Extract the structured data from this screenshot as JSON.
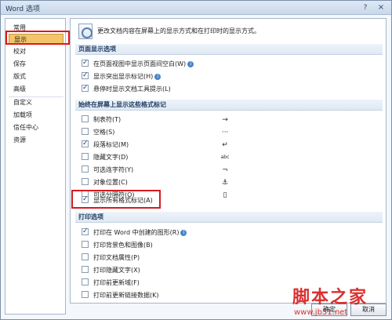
{
  "window": {
    "title": "Word 选项",
    "help_glyph": "?",
    "close_glyph": "×"
  },
  "sidebar": {
    "items": [
      {
        "label": "常用"
      },
      {
        "label": "显示",
        "selected": true
      },
      {
        "label": "校对"
      },
      {
        "label": "保存"
      },
      {
        "label": "版式"
      },
      {
        "label": "高级"
      },
      {
        "label": "自定义"
      },
      {
        "label": "加载项"
      },
      {
        "label": "信任中心"
      },
      {
        "label": "资源"
      }
    ]
  },
  "intro": {
    "text": "更改文档内容在屏幕上的显示方式和在打印时的显示方式。"
  },
  "sections": {
    "page_display": {
      "title": "页面显示选项",
      "options": [
        {
          "label": "在页面视图中显示页面间空白(W)",
          "checked": true,
          "info": "i"
        },
        {
          "label": "显示突出显示标记(H)",
          "checked": true,
          "info": "i"
        },
        {
          "label": "悬停时显示文档工具提示(L)",
          "checked": true
        }
      ]
    },
    "formatting_marks": {
      "title": "始终在屏幕上显示这些格式标记",
      "options": [
        {
          "label": "制表符(T)",
          "checked": false,
          "glyph": "→"
        },
        {
          "label": "空格(S)",
          "checked": false,
          "glyph": "···"
        },
        {
          "label": "段落标记(M)",
          "checked": true,
          "glyph": "↵"
        },
        {
          "label": "隐藏文字(D)",
          "checked": false,
          "glyph": "abc"
        },
        {
          "label": "可选连字符(Y)",
          "checked": false,
          "glyph": "¬"
        },
        {
          "label": "对象位置(C)",
          "checked": false,
          "glyph": "⚓"
        },
        {
          "label": "可选分隔符(O)",
          "checked": false,
          "glyph": "▯"
        },
        {
          "label": "显示所有格式标记(A)",
          "checked": true
        }
      ]
    },
    "printing": {
      "title": "打印选项",
      "options": [
        {
          "label": "打印在 Word 中创建的图形(R)",
          "checked": true,
          "info": "i"
        },
        {
          "label": "打印背景色和图像(B)",
          "checked": false
        },
        {
          "label": "打印文档属性(P)",
          "checked": false
        },
        {
          "label": "打印隐藏文字(X)",
          "checked": false
        },
        {
          "label": "打印前更新域(F)",
          "checked": false
        },
        {
          "label": "打印前更新链接数据(K)",
          "checked": false
        }
      ]
    }
  },
  "buttons": {
    "ok": "确定",
    "cancel": "取消"
  },
  "watermark": {
    "text": "脚本之家",
    "url": "www.jb51.net"
  },
  "colors": {
    "highlight_red": "#e0181a",
    "selected_nav": "#f3c56a",
    "section_header": "#dfe8f3"
  }
}
